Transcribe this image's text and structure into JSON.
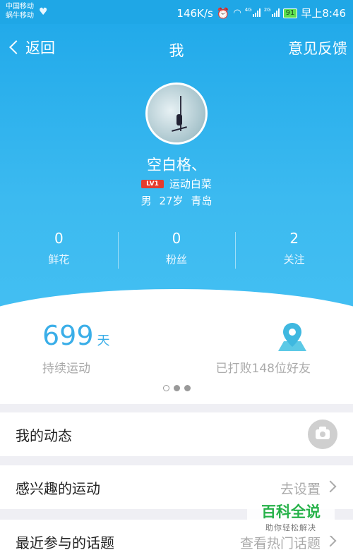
{
  "status_bar": {
    "carrier1": "中国移动",
    "carrier2": "蜗牛移动",
    "speed": "146K/s",
    "sig1_tag": "4G",
    "sig2_tag": "2G",
    "battery": "91",
    "time": "早上8:46"
  },
  "nav": {
    "back_label": "返回",
    "title": "我",
    "feedback_label": "意见反馈"
  },
  "profile": {
    "name": "空白格、",
    "level_badge": "LV1",
    "level_title": "运动白菜",
    "gender": "男",
    "age": "27岁",
    "city": "青岛"
  },
  "stats": [
    {
      "value": "0",
      "label": "鲜花"
    },
    {
      "value": "0",
      "label": "粉丝"
    },
    {
      "value": "2",
      "label": "关注"
    }
  ],
  "summary": {
    "days_value": "699",
    "days_unit": "天",
    "days_label": "持续运动",
    "beat_label": "已打败148位好友",
    "pager_active_index": 0,
    "pager_count": 3
  },
  "list": {
    "moments": {
      "title": "我的动态"
    },
    "interests": {
      "title": "感兴趣的运动",
      "value": "去设置"
    },
    "topics": {
      "title": "最近参与的话题",
      "value": "查看热门话题"
    }
  },
  "watermark": {
    "title": "百科全说",
    "subtitle": "助你轻松解决"
  },
  "colors": {
    "header": "#22aaea",
    "accent": "#3aaee8",
    "badge": "#e53c2e",
    "watermark": "#27b24a"
  }
}
